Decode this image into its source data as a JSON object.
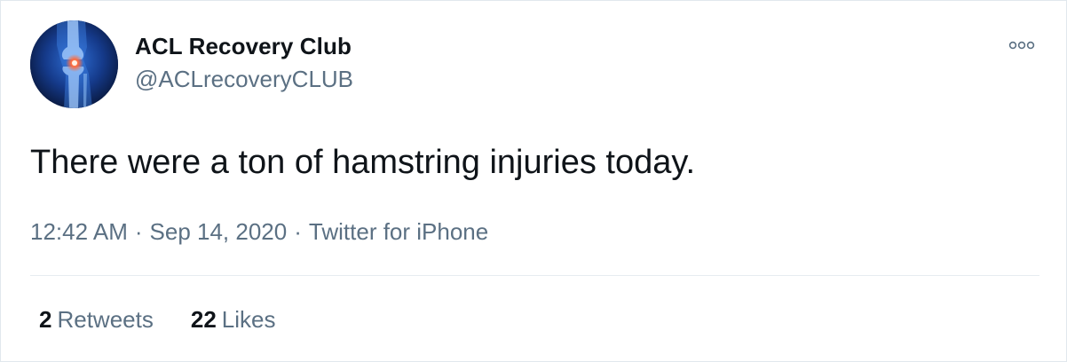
{
  "author": {
    "display_name": "ACL Recovery Club",
    "handle": "@ACLrecoveryCLUB",
    "avatar_icon": "knee-joint-icon"
  },
  "more_icon": "more-options-icon",
  "tweet": {
    "text": "There were a ton of hamstring injuries today.",
    "time": "12:42 AM",
    "separator": "·",
    "date": "Sep 14, 2020",
    "source": "Twitter for iPhone"
  },
  "stats": {
    "retweets_count": "2",
    "retweets_label": "Retweets",
    "likes_count": "22",
    "likes_label": "Likes"
  },
  "colors": {
    "text_primary": "#0f1419",
    "text_secondary": "#5b7083",
    "border": "#e1e8ed",
    "avatar_bg": "#0b1d4a",
    "avatar_highlight": "#ff6a3d"
  }
}
